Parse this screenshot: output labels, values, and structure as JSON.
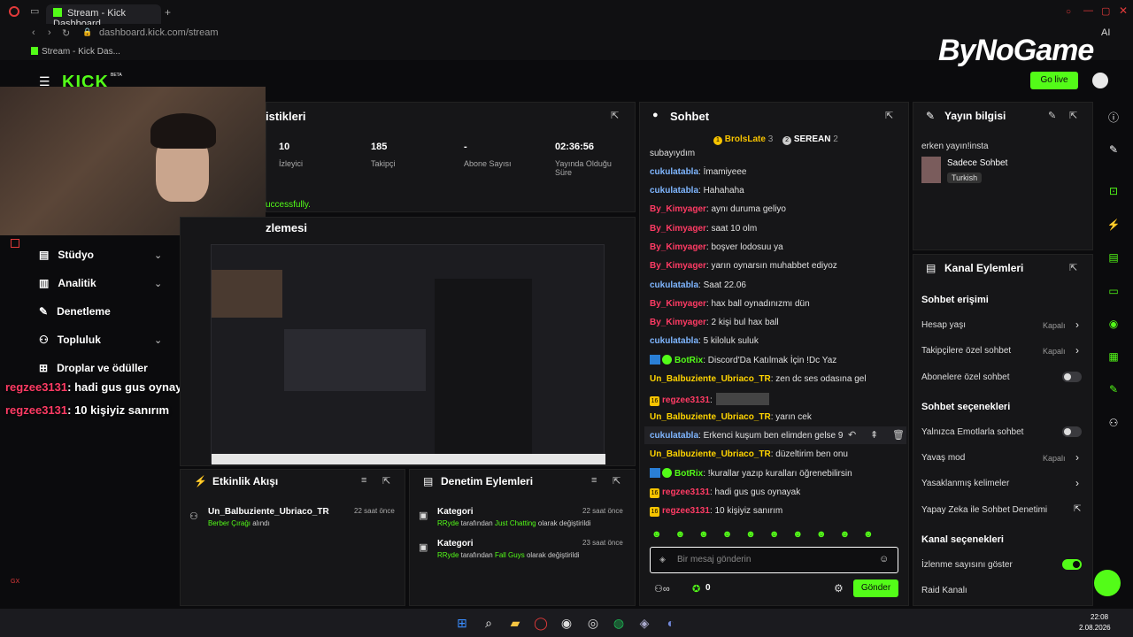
{
  "browser": {
    "tab_title": "Stream - Kick Dashboard",
    "new_tab": "+",
    "url": "dashboard.kick.com/stream",
    "bookmark": "Stream - Kick Das...",
    "ai_label": "AI"
  },
  "header": {
    "logo": "KICK",
    "beta": "BETA",
    "go_live": "Go live",
    "brand_overlay": "ByNoGame"
  },
  "stats": {
    "title_fragment": "istikleri",
    "items": [
      {
        "value": "10",
        "label": "İzleyici"
      },
      {
        "value": "185",
        "label": "Takipçi"
      },
      {
        "value": "-",
        "label": "Abone Sayısı"
      },
      {
        "value": "02:36:56",
        "label": "Yayında Olduğu Süre"
      }
    ],
    "success_fragment": "uccessfully."
  },
  "preview": {
    "title_fragment": "zlemesi"
  },
  "sidebar": {
    "items": [
      {
        "label": "Stüdyo",
        "expandable": true
      },
      {
        "label": "Analitik",
        "expandable": true
      },
      {
        "label": "Denetleme",
        "expandable": false
      },
      {
        "label": "Topluluk",
        "expandable": true
      },
      {
        "label": "Droplar ve ödüller",
        "expandable": false
      }
    ]
  },
  "overlay_chat": [
    {
      "user": "regzee3131",
      "message": ": hadi gus gus oynayak"
    },
    {
      "user": "regzee3131",
      "message": ": 10 kişiyiz sanırım"
    }
  ],
  "activity": {
    "title": "Etkinlik Akışı",
    "events": [
      {
        "user": "Un_Balbuziente_Ubriaco_TR",
        "detail_green": "Berber Çırağı",
        "detail": " alındı",
        "time": "22 saat önce"
      }
    ]
  },
  "moderation": {
    "title": "Denetim Eylemleri",
    "events": [
      {
        "title": "Kategori",
        "actor": "RRyde",
        "text1": " tarafından ",
        "target": "Just Chatting",
        "text2": " olarak değiştirildi",
        "time": "22 saat önce"
      },
      {
        "title": "Kategori",
        "actor": "RRyde",
        "text1": " tarafından ",
        "target": "Fall Guys",
        "text2": " olarak değiştirildi",
        "time": "23 saat önce"
      }
    ]
  },
  "chat": {
    "title": "Sohbet",
    "leaders": [
      {
        "rank": "1",
        "name": "BrolsLate",
        "count": "3"
      },
      {
        "rank": "2",
        "name": "SEREAN",
        "count": "2"
      }
    ],
    "partial_line": "subayıydım",
    "messages": [
      {
        "user": "cukulatabla",
        "color": "blue",
        "text": ": İmamiyeee"
      },
      {
        "user": "cukulatabla",
        "color": "blue",
        "text": ": Hahahaha"
      },
      {
        "user": "By_Kimyager",
        "color": "red",
        "text": ": aynı duruma geliyo"
      },
      {
        "user": "By_Kimyager",
        "color": "red",
        "text": ": saat 10 olm"
      },
      {
        "user": "By_Kimyager",
        "color": "red",
        "text": ": boşver lodosuu ya"
      },
      {
        "user": "By_Kimyager",
        "color": "red",
        "text": ": yarın oynarsın muhabbet ediyoz"
      },
      {
        "user": "cukulatabla",
        "color": "blue",
        "text": ": Saat 22.06"
      },
      {
        "user": "By_Kimyager",
        "color": "red",
        "text": ": hax ball oynadınızmı dün"
      },
      {
        "user": "By_Kimyager",
        "color": "red",
        "text": ": 2 kişi bul hax ball"
      },
      {
        "user": "cukulatabla",
        "color": "blue",
        "text": ": 5 kiloluk suluk"
      },
      {
        "user": "BotRix",
        "color": "green",
        "text": ": Discord'Da Katılmak İçin !Dc Yaz",
        "bot": true
      },
      {
        "user": "Un_Balbuziente_Ubriaco_TR",
        "color": "yellow",
        "text": ": zen dc ses odasına gel"
      },
      {
        "user": "regzee3131",
        "color": "red",
        "text": ":",
        "badge": "16"
      },
      {
        "user": "Un_Balbuziente_Ubriaco_TR",
        "color": "yellow",
        "text": ": yarın cek"
      },
      {
        "user": "cukulatabla",
        "color": "blue",
        "text": ": Erkenci kuşum ben elimden gelse 9"
      },
      {
        "user": "Un_Balbuziente_Ubriaco_TR",
        "color": "yellow",
        "text": ": düzeltirim ben onu"
      },
      {
        "user": "BotRix",
        "color": "green",
        "text": ": !kurallar yazıp kuralları öğrenebilirsin",
        "bot": true
      },
      {
        "user": "regzee3131",
        "color": "red",
        "text": ": hadi gus gus oynayak",
        "badge": "16"
      },
      {
        "user": "regzee3131",
        "color": "red",
        "text": ": 10 kişiyiz sanırım",
        "badge": "16"
      }
    ],
    "input_placeholder": "Bir mesaj gönderin",
    "points": "0",
    "send_label": "Gönder"
  },
  "stream_info": {
    "title": "Yayın bilgisi",
    "stream_title": "erken yayın!insta",
    "category": "Sadece Sohbet",
    "language_tag": "Turkish"
  },
  "channel_actions": {
    "title": "Kanal Eylemleri",
    "sections": {
      "chat_access": "Sohbet erişimi",
      "chat_options": "Sohbet seçenekleri",
      "channel_options": "Kanal seçenekleri"
    },
    "rows": [
      {
        "label": "Hesap yaşı",
        "value": "Kapalı",
        "kind": "arrow"
      },
      {
        "label": "Takipçilere özel sohbet",
        "value": "Kapalı",
        "kind": "arrow"
      },
      {
        "label": "Abonelere özel sohbet",
        "kind": "toggle",
        "on": false
      },
      {
        "label": "Yalnızca Emotlarla sohbet",
        "kind": "toggle",
        "on": false
      },
      {
        "label": "Yavaş mod",
        "value": "Kapalı",
        "kind": "arrow"
      },
      {
        "label": "Yasaklanmış kelimeler",
        "kind": "arrow"
      },
      {
        "label": "Yapay Zeka ile Sohbet Denetimi",
        "kind": "external"
      },
      {
        "label": "İzlenme sayısını göster",
        "kind": "toggle",
        "on": true
      },
      {
        "label": "Raid Kanalı",
        "kind": "none"
      }
    ]
  },
  "taskbar": {
    "time": "22:08",
    "date": "2.08.2026"
  },
  "colors": {
    "accent": "#53fc18",
    "panel": "#161618",
    "background": "#0b0b0d"
  }
}
